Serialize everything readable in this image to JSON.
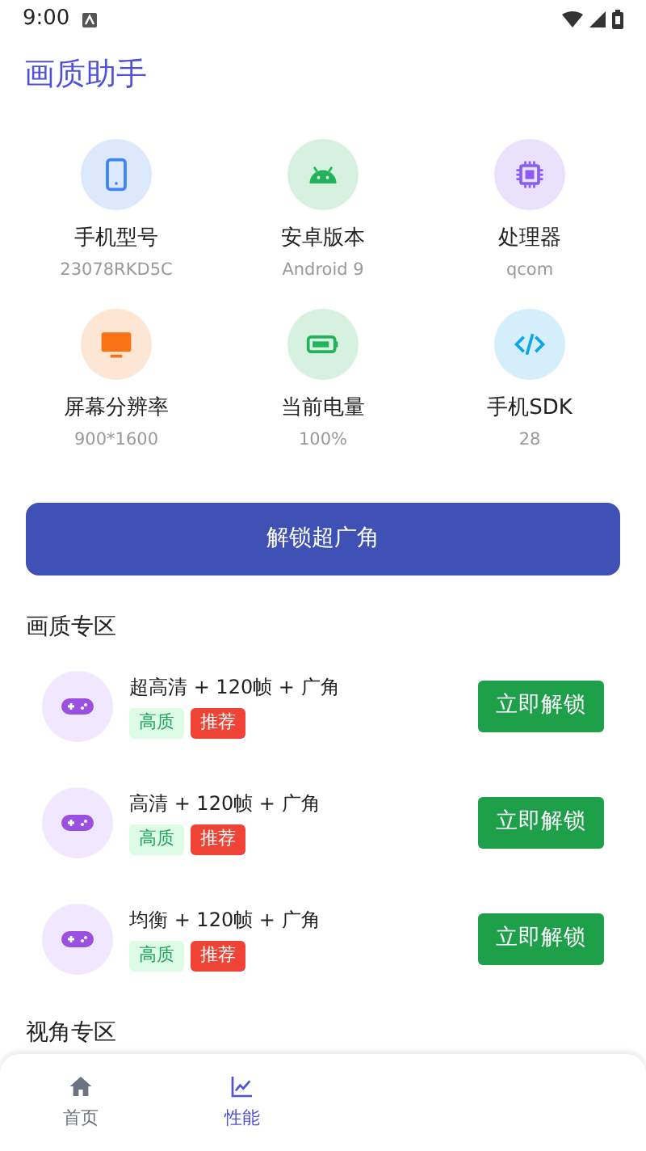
{
  "status_bar": {
    "time": "9:00"
  },
  "app_bar": {
    "title": "画质助手"
  },
  "info_items": [
    {
      "label": "手机型号",
      "value": "23078RKD5C"
    },
    {
      "label": "安卓版本",
      "value": "Android 9"
    },
    {
      "label": "处理器",
      "value": "qcom"
    },
    {
      "label": "屏幕分辨率",
      "value": "900*1600"
    },
    {
      "label": "当前电量",
      "value": "100%"
    },
    {
      "label": "手机SDK",
      "value": "28"
    }
  ],
  "unlock_button": "解锁超广角",
  "sections": [
    {
      "title": "画质专区",
      "items": [
        {
          "title": "超高清 + 120帧 + 广角",
          "tags": [
            {
              "text": "高质",
              "kind": "quality"
            },
            {
              "text": "推荐",
              "kind": "recommend"
            }
          ],
          "button": "立即解锁"
        },
        {
          "title": "高清 + 120帧 + 广角",
          "tags": [
            {
              "text": "高质",
              "kind": "quality"
            },
            {
              "text": "推荐",
              "kind": "recommend"
            }
          ],
          "button": "立即解锁"
        },
        {
          "title": "均衡 + 120帧 + 广角",
          "tags": [
            {
              "text": "高质",
              "kind": "quality"
            },
            {
              "text": "推荐",
              "kind": "recommend"
            }
          ],
          "button": "立即解锁"
        }
      ]
    },
    {
      "title": "视角专区"
    }
  ],
  "bottom_nav": [
    {
      "label": "首页",
      "selected": false
    },
    {
      "label": "性能",
      "selected": true
    }
  ]
}
